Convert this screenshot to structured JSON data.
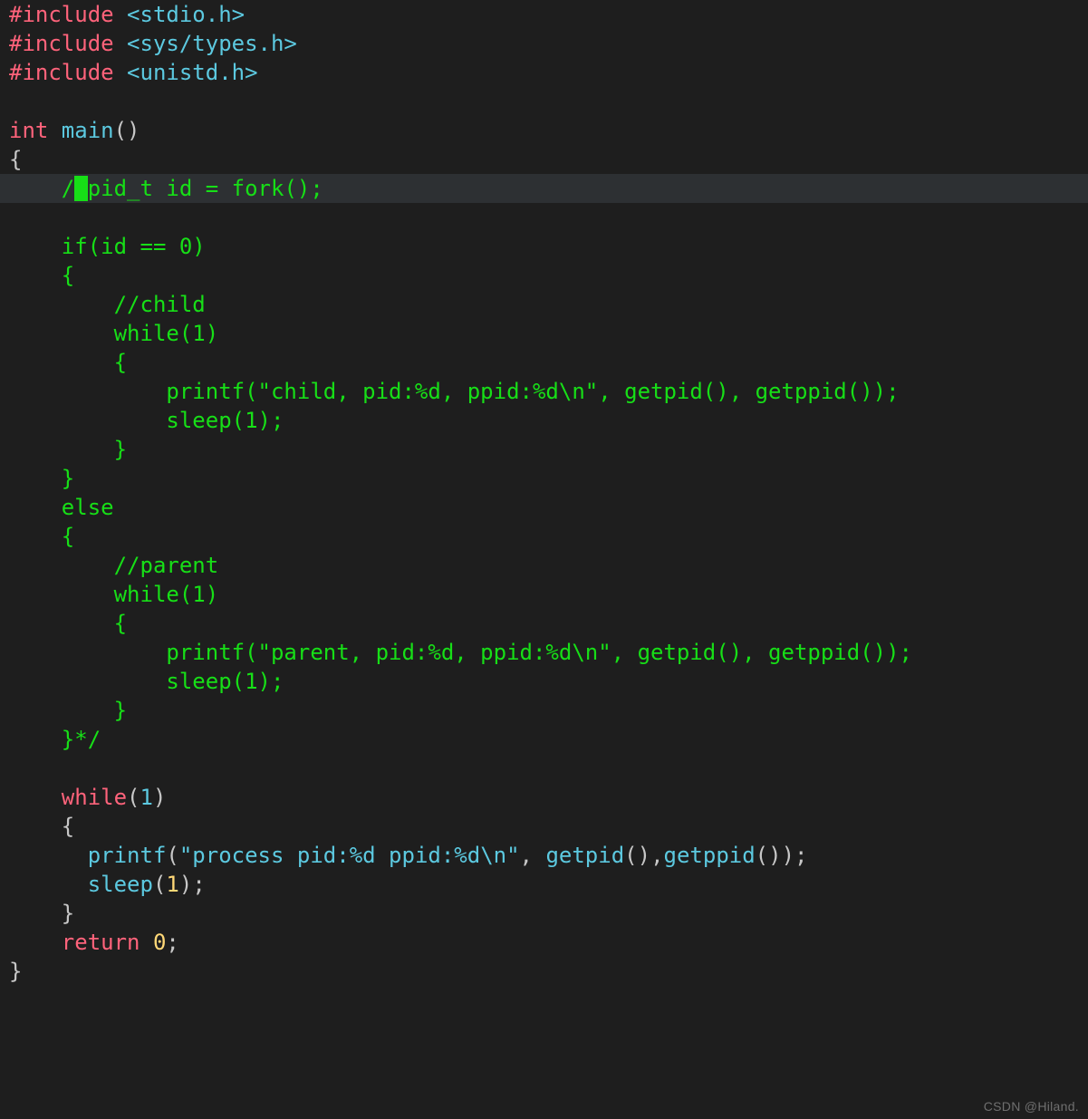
{
  "watermark": "CSDN @Hiland.",
  "code": {
    "l1": {
      "directive": "#include",
      "path": " <stdio.h>"
    },
    "l2": {
      "directive": "#include",
      "path": " <sys/types.h>"
    },
    "l3": {
      "directive": "#include",
      "path": " <unistd.h>"
    },
    "l5": {
      "kw": "int",
      "fn": " main",
      "par": "()"
    },
    "l6": {
      "brace": "{"
    },
    "l7": {
      "indent": "    ",
      "body": "pid_t id = fork();",
      "slash": "/",
      "cursor": "*"
    },
    "l9": {
      "indent": "    ",
      "body": "if(id == 0)"
    },
    "l10": {
      "indent": "    ",
      "body": "{"
    },
    "l11": {
      "indent": "        ",
      "body": "//child"
    },
    "l12": {
      "indent": "        ",
      "body": "while(1)"
    },
    "l13": {
      "indent": "        ",
      "body": "{"
    },
    "l14": {
      "indent": "            ",
      "body": "printf(\"child, pid:%d, ppid:%d\\n\", getpid(), getppid());"
    },
    "l15": {
      "indent": "            ",
      "body": "sleep(1);"
    },
    "l16": {
      "indent": "        ",
      "body": "}"
    },
    "l17": {
      "indent": "    ",
      "body": "}"
    },
    "l18": {
      "indent": "    ",
      "body": "else"
    },
    "l19": {
      "indent": "    ",
      "body": "{"
    },
    "l20": {
      "indent": "        ",
      "body": "//parent"
    },
    "l21": {
      "indent": "        ",
      "body": "while(1)"
    },
    "l22": {
      "indent": "        ",
      "body": "{"
    },
    "l23": {
      "indent": "            ",
      "body": "printf(\"parent, pid:%d, ppid:%d\\n\", getpid(), getppid());"
    },
    "l24": {
      "indent": "            ",
      "body": "sleep(1);"
    },
    "l25": {
      "indent": "        ",
      "body": "}"
    },
    "l26": {
      "indent": "    ",
      "body": "}*/"
    },
    "l28": {
      "indent": "    ",
      "kw": "while",
      "paren_o": "(",
      "num": "1",
      "paren_c": ")"
    },
    "l29": {
      "indent": "    ",
      "brace": "{"
    },
    "l30": {
      "indent": "      ",
      "call": "printf",
      "po": "(",
      "str": "\"process pid:%d ppid:%d\\n\"",
      "c1": ", ",
      "a1": "getpid",
      "a1p": "()",
      "c2": ",",
      "a2": "getppid",
      "a2p": "()",
      "pc": ")",
      "semi": ";"
    },
    "l31": {
      "indent": "      ",
      "call": "sleep",
      "po": "(",
      "num": "1",
      "pc": ")",
      "semi": ";"
    },
    "l32": {
      "indent": "    ",
      "brace": "}"
    },
    "l33": {
      "indent": "    ",
      "kw": "return",
      "sp": " ",
      "num": "0",
      "semi": ";"
    },
    "l34": {
      "brace": "}"
    }
  }
}
